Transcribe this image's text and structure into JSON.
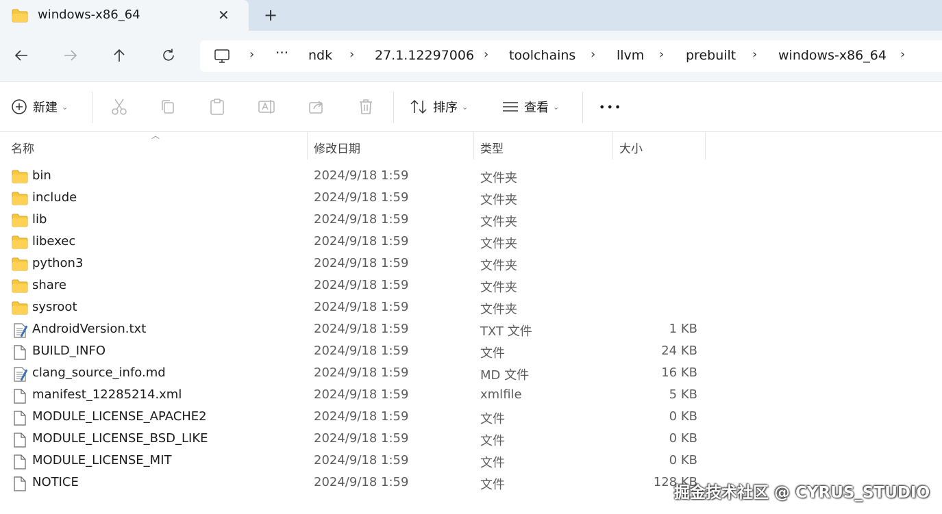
{
  "tab": {
    "title": "windows-x86_64",
    "close_glyph": "✕",
    "new_glyph": "+"
  },
  "nav": {
    "back_icon": "arrow-left-icon",
    "forward_icon": "arrow-right-icon",
    "up_icon": "arrow-up-icon",
    "refresh_icon": "refresh-icon",
    "breadcrumbs": [
      "ndk",
      "27.1.12297006",
      "toolchains",
      "llvm",
      "prebuilt",
      "windows-x86_64"
    ],
    "overflow": "···"
  },
  "command_bar": {
    "new_label": "新建",
    "sort_label": "排序",
    "view_label": "查看",
    "more_glyph": "•••"
  },
  "columns": {
    "name": "名称",
    "date": "修改日期",
    "type": "类型",
    "size": "大小"
  },
  "files": [
    {
      "name": "bin",
      "date": "2024/9/18 1:59",
      "type": "文件夹",
      "size": "",
      "icon": "folder"
    },
    {
      "name": "include",
      "date": "2024/9/18 1:59",
      "type": "文件夹",
      "size": "",
      "icon": "folder"
    },
    {
      "name": "lib",
      "date": "2024/9/18 1:59",
      "type": "文件夹",
      "size": "",
      "icon": "folder"
    },
    {
      "name": "libexec",
      "date": "2024/9/18 1:59",
      "type": "文件夹",
      "size": "",
      "icon": "folder"
    },
    {
      "name": "python3",
      "date": "2024/9/18 1:59",
      "type": "文件夹",
      "size": "",
      "icon": "folder"
    },
    {
      "name": "share",
      "date": "2024/9/18 1:59",
      "type": "文件夹",
      "size": "",
      "icon": "folder"
    },
    {
      "name": "sysroot",
      "date": "2024/9/18 1:59",
      "type": "文件夹",
      "size": "",
      "icon": "folder"
    },
    {
      "name": "AndroidVersion.txt",
      "date": "2024/9/18 1:59",
      "type": "TXT 文件",
      "size": "1 KB",
      "icon": "text-file"
    },
    {
      "name": "BUILD_INFO",
      "date": "2024/9/18 1:59",
      "type": "文件",
      "size": "24 KB",
      "icon": "blank-file"
    },
    {
      "name": "clang_source_info.md",
      "date": "2024/9/18 1:59",
      "type": "MD 文件",
      "size": "16 KB",
      "icon": "text-file"
    },
    {
      "name": "manifest_12285214.xml",
      "date": "2024/9/18 1:59",
      "type": "xmlfile",
      "size": "5 KB",
      "icon": "blank-file"
    },
    {
      "name": "MODULE_LICENSE_APACHE2",
      "date": "2024/9/18 1:59",
      "type": "文件",
      "size": "0 KB",
      "icon": "blank-file"
    },
    {
      "name": "MODULE_LICENSE_BSD_LIKE",
      "date": "2024/9/18 1:59",
      "type": "文件",
      "size": "0 KB",
      "icon": "blank-file"
    },
    {
      "name": "MODULE_LICENSE_MIT",
      "date": "2024/9/18 1:59",
      "type": "文件",
      "size": "0 KB",
      "icon": "blank-file"
    },
    {
      "name": "NOTICE",
      "date": "2024/9/18 1:59",
      "type": "文件",
      "size": "128 KB",
      "icon": "blank-file"
    }
  ],
  "watermark": "掘金技术社区 @ CYRUS_STUDIO",
  "colors": {
    "folder": "#f8c740",
    "tabstrip": "#d7e3ee",
    "toolbar_bg": "#f3f6f9"
  }
}
